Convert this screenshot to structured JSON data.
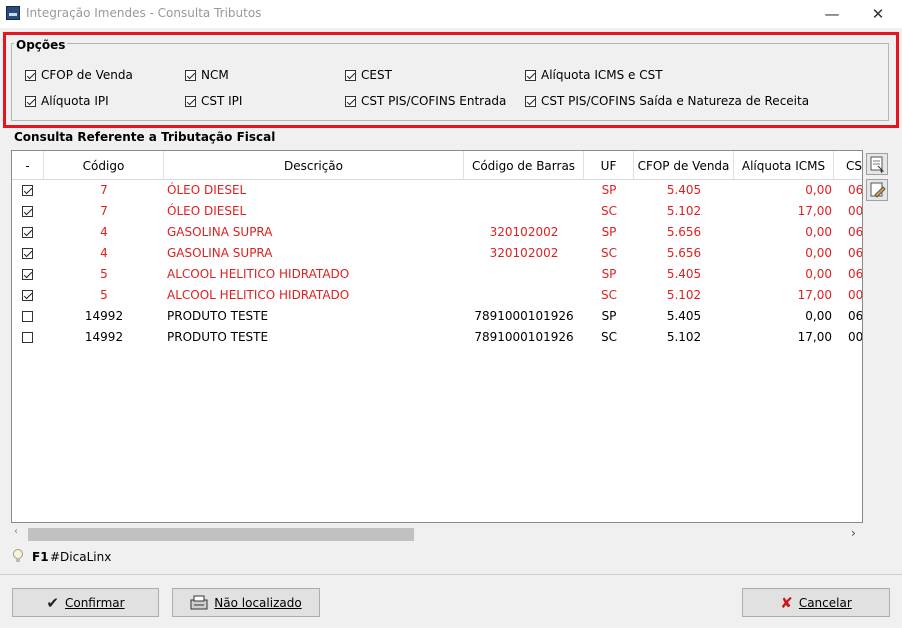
{
  "window": {
    "title": "Integração Imendes - Consulta Tributos",
    "minimize": "—",
    "maximize": "☐",
    "close": "✕"
  },
  "opcoes": {
    "legend": "Opções",
    "items": [
      {
        "label": "CFOP de Venda",
        "checked": true
      },
      {
        "label": "NCM",
        "checked": true
      },
      {
        "label": "CEST",
        "checked": true
      },
      {
        "label": "Alíquota ICMS e CST",
        "checked": true
      },
      {
        "label": "Alíquota IPI",
        "checked": true
      },
      {
        "label": "CST IPI",
        "checked": true
      },
      {
        "label": "CST PIS/COFINS Entrada",
        "checked": true
      },
      {
        "label": "CST PIS/COFINS Saída e Natureza de Receita",
        "checked": true
      }
    ]
  },
  "consulta": {
    "label": "Consulta Referente a Tributação Fiscal",
    "columns": [
      "-",
      "Código",
      "Descrição",
      "Código de Barras",
      "UF",
      "CFOP de Venda",
      "Alíquota ICMS",
      "CS"
    ],
    "rows": [
      {
        "checked": true,
        "red": true,
        "codigo": "7",
        "descricao": "ÓLEO DIESEL",
        "barras": "",
        "uf": "SP",
        "cfop": "5.405",
        "aliquota": "0,00",
        "cs": "06"
      },
      {
        "checked": true,
        "red": true,
        "codigo": "7",
        "descricao": "ÓLEO DIESEL",
        "barras": "",
        "uf": "SC",
        "cfop": "5.102",
        "aliquota": "17,00",
        "cs": "00"
      },
      {
        "checked": true,
        "red": true,
        "codigo": "4",
        "descricao": "GASOLINA SUPRA",
        "barras": "320102002",
        "uf": "SP",
        "cfop": "5.656",
        "aliquota": "0,00",
        "cs": "06"
      },
      {
        "checked": true,
        "red": true,
        "codigo": "4",
        "descricao": "GASOLINA SUPRA",
        "barras": "320102002",
        "uf": "SC",
        "cfop": "5.656",
        "aliquota": "0,00",
        "cs": "06"
      },
      {
        "checked": true,
        "red": true,
        "codigo": "5",
        "descricao": "ALCOOL HELITICO HIDRATADO",
        "barras": "",
        "uf": "SP",
        "cfop": "5.405",
        "aliquota": "0,00",
        "cs": "06"
      },
      {
        "checked": true,
        "red": true,
        "codigo": "5",
        "descricao": "ALCOOL HELITICO HIDRATADO",
        "barras": "",
        "uf": "SC",
        "cfop": "5.102",
        "aliquota": "17,00",
        "cs": "00"
      },
      {
        "checked": false,
        "red": false,
        "codigo": "14992",
        "descricao": "PRODUTO TESTE",
        "barras": "7891000101926",
        "uf": "SP",
        "cfop": "5.405",
        "aliquota": "0,00",
        "cs": "06"
      },
      {
        "checked": false,
        "red": false,
        "codigo": "14992",
        "descricao": "PRODUTO TESTE",
        "barras": "7891000101926",
        "uf": "SC",
        "cfop": "5.102",
        "aliquota": "17,00",
        "cs": "00"
      }
    ]
  },
  "tip": {
    "key": "F1",
    "text": "#DicaLinx"
  },
  "buttons": {
    "confirmar": "Confirmar",
    "nao_localizado": "Não localizado",
    "cancelar": "Cancelar"
  },
  "colors": {
    "highlight_border": "#e8131f",
    "red_text": "#e02020"
  }
}
